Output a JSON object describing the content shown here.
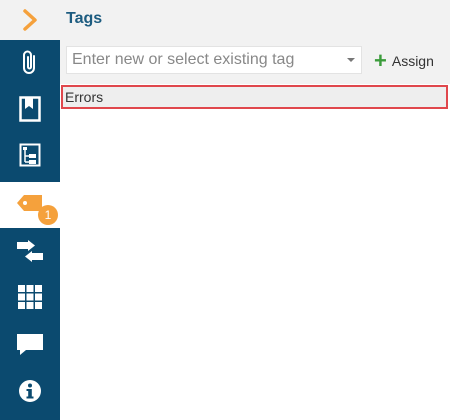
{
  "sidebar": {
    "items": [
      {
        "name": "expand",
        "icon": "chevron-right-icon"
      },
      {
        "name": "attachments",
        "icon": "paperclip-icon"
      },
      {
        "name": "bookmarks",
        "icon": "bookmark-icon"
      },
      {
        "name": "outline",
        "icon": "tree-structure-icon"
      },
      {
        "name": "tags",
        "icon": "tag-icon",
        "active": true,
        "badge": "1"
      },
      {
        "name": "links",
        "icon": "transfer-icon"
      },
      {
        "name": "grid",
        "icon": "grid-icon"
      },
      {
        "name": "comments",
        "icon": "comment-icon"
      },
      {
        "name": "info",
        "icon": "info-icon"
      }
    ]
  },
  "panel": {
    "title": "Tags",
    "tag_input": {
      "placeholder": "Enter new or select existing tag",
      "value": ""
    },
    "assign_label": "Assign",
    "tags": [
      "Errors"
    ]
  },
  "colors": {
    "sidebar_bg": "#0b4a6f",
    "accent_orange": "#f5a13c",
    "title_blue": "#1d5c80",
    "assign_green": "#3b9c3b",
    "selection_border": "#e0474c"
  }
}
